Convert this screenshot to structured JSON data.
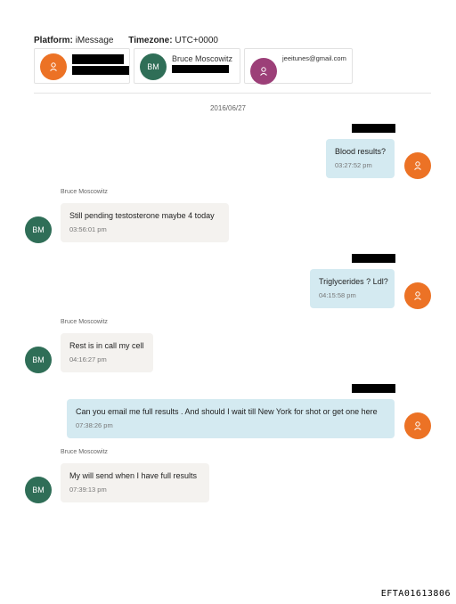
{
  "header": {
    "platform_label": "Platform:",
    "platform_value": "iMessage",
    "timezone_label": "Timezone:",
    "timezone_value": "UTC+0000"
  },
  "participants": [
    {
      "avatar_icon": "person-icon",
      "color": "#ec7225",
      "name": "",
      "redacted": true
    },
    {
      "initials": "BM",
      "color": "#2f6e57",
      "name": "Bruce Moscowitz",
      "redacted": true
    },
    {
      "avatar_icon": "person-icon",
      "color": "#9c3f78",
      "name": "jeeitunes@gmail.com"
    }
  ],
  "conversation": {
    "date": "2016/06/27",
    "messages": [
      {
        "direction": "outgoing",
        "sender": "",
        "sender_redacted": true,
        "text": "Blood results?",
        "time": "03:27:52 pm"
      },
      {
        "direction": "incoming",
        "sender": "Bruce Moscowitz",
        "initials": "BM",
        "text": "Still pending testosterone maybe 4 today",
        "time": "03:56:01 pm"
      },
      {
        "direction": "outgoing",
        "sender": "",
        "sender_redacted": true,
        "text": "Triglycerides ? Ldl?",
        "time": "04:15:58 pm"
      },
      {
        "direction": "incoming",
        "sender": "Bruce Moscowitz",
        "initials": "BM",
        "text": "Rest is in call my cell",
        "time": "04:16:27 pm"
      },
      {
        "direction": "outgoing",
        "sender": "",
        "sender_redacted": true,
        "text": "Can you email me full results . And should I wait till New York for shot or get one here",
        "time": "07:38:26 pm"
      },
      {
        "direction": "incoming",
        "sender": "Bruce Moscowitz",
        "initials": "BM",
        "text": "My will send when I have full results",
        "time": "07:39:13 pm"
      }
    ]
  },
  "footer": {
    "document_id": "EFTA01613806"
  },
  "colors": {
    "outgoing_bubble": "#d4eaf1",
    "incoming_bubble": "#f4f2ef",
    "orange_avatar": "#ec7225",
    "green_avatar": "#2f6e57",
    "purple_avatar": "#9c3f78"
  }
}
